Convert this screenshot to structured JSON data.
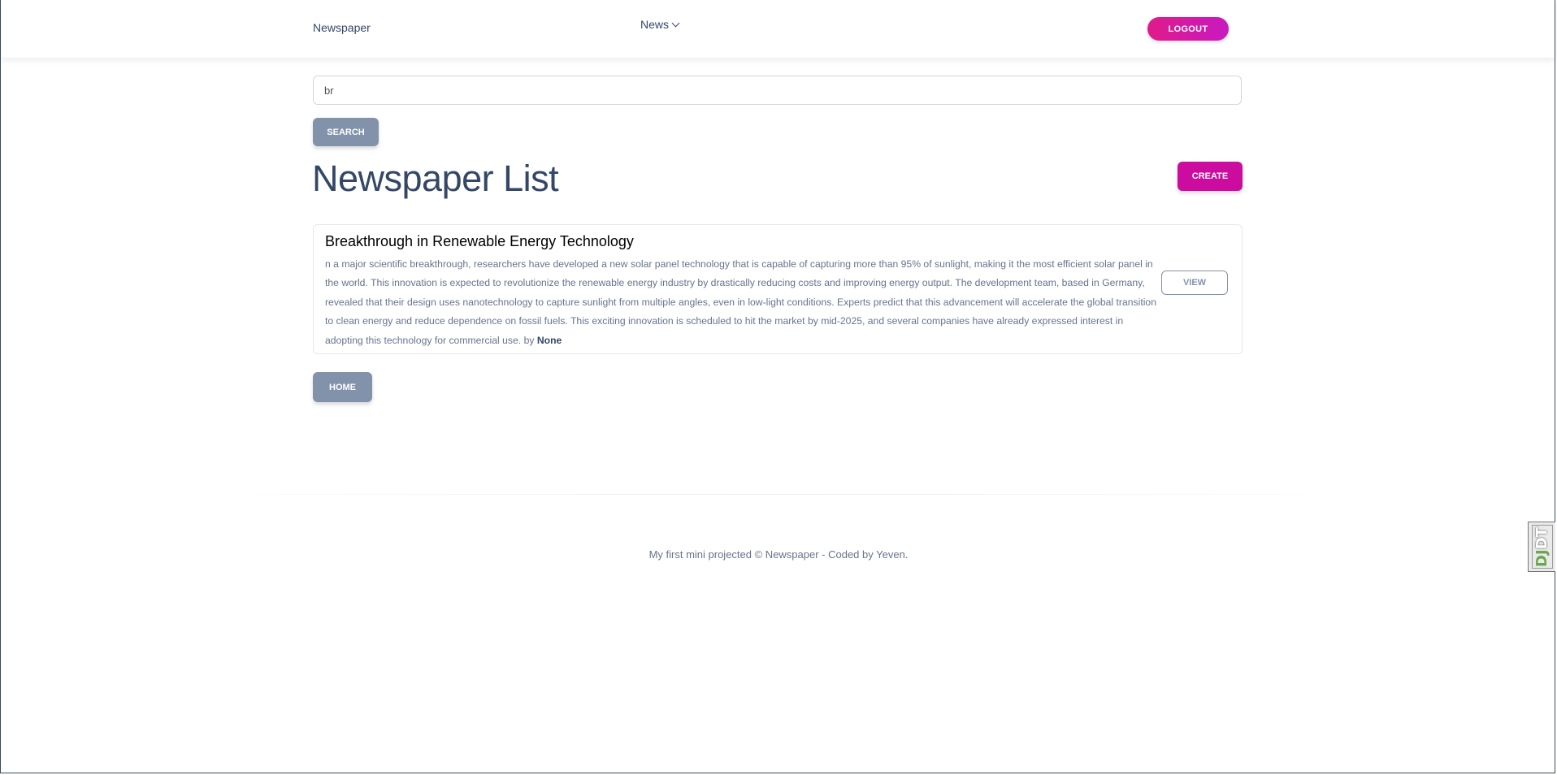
{
  "navbar": {
    "brand": "Newspaper",
    "news_menu": "News",
    "logout_label": "LOGOUT"
  },
  "search": {
    "value": "br",
    "button_label": "SEARCH"
  },
  "page": {
    "title": "Newspaper List",
    "create_label": "CREATE"
  },
  "articles": [
    {
      "title": "Breakthrough in Renewable Energy Technology",
      "body": "n a major scientific breakthrough, researchers have developed a new solar panel technology that is capable of capturing more than 95% of sunlight, making it the most efficient solar panel in the world. This innovation is expected to revolutionize the renewable energy industry by drastically reducing costs and improving energy output. The development team, based in Germany, revealed that their design uses nanotechnology to capture sunlight from multiple angles, even in low-light conditions. Experts predict that this advancement will accelerate the global transition to clean energy and reduce dependence on fossil fuels. This exciting innovation is scheduled to hit the market by mid-2025, and several companies have already expressed interest in adopting this technology for commercial use.",
      "by_prefix": "by",
      "author": "None",
      "view_label": "VIEW"
    }
  ],
  "home_label": "HOME",
  "footer": {
    "text": "My first mini projected © Newspaper - Coded by Yeven."
  },
  "debug_toolbar": {
    "dj": "DJ",
    "dt": "DT"
  },
  "colors": {
    "primary": "#cb0c9f",
    "secondary": "#8392ab",
    "text_dark": "#344767",
    "text_muted": "#67748e"
  }
}
